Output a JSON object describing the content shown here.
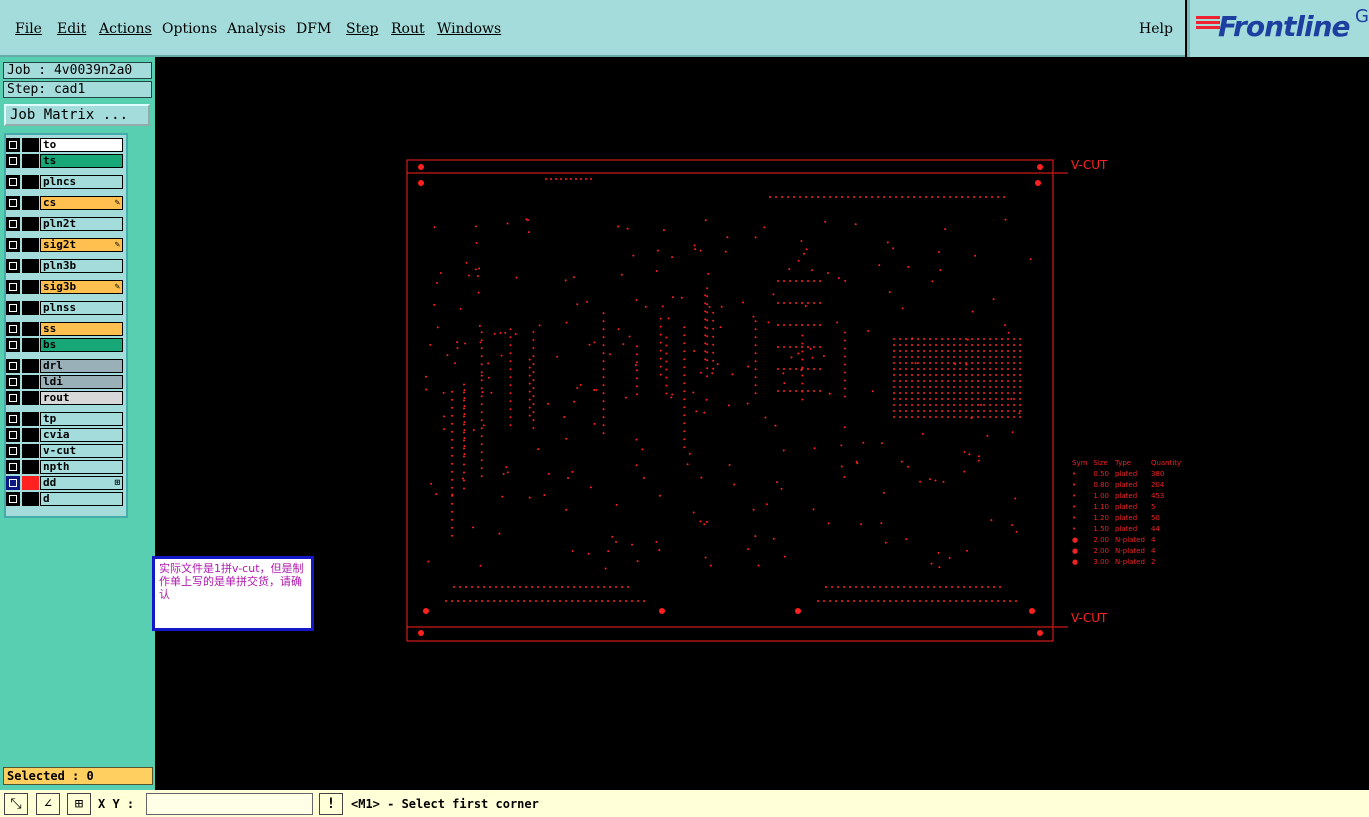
{
  "menu": {
    "items": [
      {
        "label": "File",
        "underline": true
      },
      {
        "label": "Edit",
        "underline": true
      },
      {
        "label": "Actions",
        "underline": true
      },
      {
        "label": "Options",
        "underline": false
      },
      {
        "label": "Analysis",
        "underline": false
      },
      {
        "label": "DFM",
        "underline": false
      },
      {
        "label": "Step",
        "underline": true
      },
      {
        "label": "Rout",
        "underline": true
      },
      {
        "label": "Windows",
        "underline": true
      }
    ],
    "help": "Help"
  },
  "logo": {
    "brand": "Frontline",
    "suffix": "G"
  },
  "job": {
    "job_label": "Job : 4v0039n2a0",
    "step_label": "Step: cad1",
    "matrix_button": "Job Matrix ..."
  },
  "layers": [
    {
      "name": "to",
      "color": "#ffffff"
    },
    {
      "name": "ts",
      "color": "#18a878"
    },
    {
      "name": "plncs",
      "color": "#a4dcdc"
    },
    {
      "name": "cs",
      "color": "#ffc050",
      "mark": true
    },
    {
      "name": "pln2t",
      "color": "#a4dcdc"
    },
    {
      "name": "sig2t",
      "color": "#ffc050",
      "mark": true
    },
    {
      "name": "pln3b",
      "color": "#a4dcdc"
    },
    {
      "name": "sig3b",
      "color": "#ffc050",
      "mark": true
    },
    {
      "name": "plnss",
      "color": "#a4dcdc"
    },
    {
      "name": "ss",
      "color": "#ffc050"
    },
    {
      "name": "bs",
      "color": "#18a878"
    },
    {
      "name": "drl",
      "color": "#9ab0b8"
    },
    {
      "name": "ldi",
      "color": "#9ab0b8"
    },
    {
      "name": "rout",
      "color": "#d8d8d8"
    },
    {
      "name": "tp",
      "color": "#a4dcdc"
    },
    {
      "name": "cvia",
      "color": "#a4dcdc"
    },
    {
      "name": "v-cut",
      "color": "#a4dcdc"
    },
    {
      "name": "npth",
      "color": "#a4dcdc"
    },
    {
      "name": "dd",
      "color": "#a4dcdc",
      "active": true
    },
    {
      "name": "d",
      "color": "#a4dcdc"
    }
  ],
  "status": {
    "selected": "Selected : 0",
    "xy_label": "X Y :",
    "xy_value": "",
    "message": "<M1> - Select first corner"
  },
  "toolbar_icons": [
    "zoom-box-icon",
    "measure-icon",
    "snap-grid-icon"
  ],
  "note": "实际文件是1拼v-cut，但是制作单上写的是单拼交货，请确认",
  "vcut_labels": {
    "top": "V-CUT",
    "bottom": "V-CUT"
  },
  "legend": {
    "headers": [
      "Sym",
      "Size",
      "Type",
      "Quantity"
    ],
    "rows": [
      [
        "•",
        "0.50",
        "plated",
        "380"
      ],
      [
        "•",
        "0.80",
        "plated",
        "204"
      ],
      [
        "•",
        "1.00",
        "plated",
        "453"
      ],
      [
        "•",
        "1.10",
        "plated",
        "5"
      ],
      [
        "•",
        "1.20",
        "plated",
        "50"
      ],
      [
        "•",
        "1.50",
        "plated",
        "44"
      ],
      [
        "●",
        "2.00",
        "N-plated",
        "4"
      ],
      [
        "●",
        "2.00",
        "N-plated",
        "4"
      ],
      [
        "●",
        "3.00",
        "N-plated",
        "2"
      ]
    ]
  },
  "colors": {
    "canvas": "#000000",
    "drill": "#ff2020",
    "sidebar": "#58cfb0",
    "panel": "#a4dcdc",
    "note_border": "#1418c8"
  }
}
